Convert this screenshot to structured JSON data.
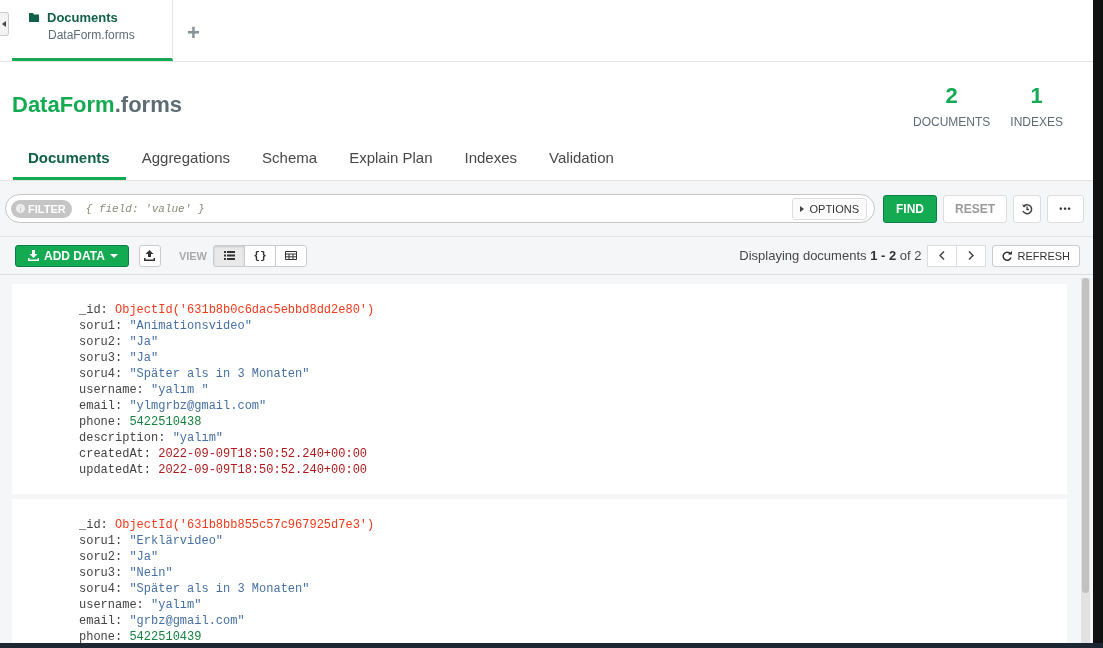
{
  "workspace_tabs": [
    {
      "title": "Documents",
      "subtitle": "DataForm.forms",
      "selected": true
    }
  ],
  "new_tab": "+",
  "collection": {
    "database": "DataForm",
    "name": ".forms"
  },
  "stats": [
    {
      "value": "2",
      "label": "DOCUMENTS"
    },
    {
      "value": "1",
      "label": "INDEXES"
    }
  ],
  "tabs": [
    {
      "label": "Documents",
      "selected": true
    },
    {
      "label": "Aggregations",
      "selected": false
    },
    {
      "label": "Schema",
      "selected": false
    },
    {
      "label": "Explain Plan",
      "selected": false
    },
    {
      "label": "Indexes",
      "selected": false
    },
    {
      "label": "Validation",
      "selected": false
    }
  ],
  "query_bar": {
    "filter_label": "FILTER",
    "placeholder": "{ field: 'value' }",
    "options": "OPTIONS",
    "find": "FIND",
    "reset": "RESET",
    "more": "•••"
  },
  "toolbar": {
    "add_data": "ADD DATA",
    "view_label": "VIEW",
    "views": [
      {
        "kind": "list",
        "selected": true
      },
      {
        "kind": "json",
        "label": "{}",
        "selected": false
      },
      {
        "kind": "table",
        "selected": false
      }
    ],
    "pagination": "Displaying documents **1 - 2** of 2",
    "refresh": "REFRESH"
  },
  "documents": [
    {
      "fields": [
        {
          "key": "_id:",
          "value": "ObjectId('631b8b0c6dac5ebbd8dd2e80')",
          "kind": "objectid"
        },
        {
          "key": "soru1:",
          "value": "\"Animationsvideo\"",
          "kind": "string"
        },
        {
          "key": "soru2:",
          "value": "\"Ja\"",
          "kind": "string"
        },
        {
          "key": "soru3:",
          "value": "\"Ja\"",
          "kind": "string"
        },
        {
          "key": "soru4:",
          "value": "\"Später als in 3 Monaten\"",
          "kind": "string"
        },
        {
          "key": "username:",
          "value": "\"yalım \"",
          "kind": "string"
        },
        {
          "key": "email:",
          "value": "\"ylmgrbz@gmail.com\"",
          "kind": "string"
        },
        {
          "key": "phone:",
          "value": "5422510438",
          "kind": "number"
        },
        {
          "key": "description:",
          "value": "\"yalım\"",
          "kind": "string"
        },
        {
          "key": "createdAt:",
          "value": "2022-09-09T18:50:52.240+00:00",
          "kind": "date"
        },
        {
          "key": "updatedAt:",
          "value": "2022-09-09T18:50:52.240+00:00",
          "kind": "date"
        }
      ]
    },
    {
      "fields": [
        {
          "key": "_id:",
          "value": "ObjectId('631b8bb855c57c967925d7e3')",
          "kind": "objectid"
        },
        {
          "key": "soru1:",
          "value": "\"Erklärvideo\"",
          "kind": "string"
        },
        {
          "key": "soru2:",
          "value": "\"Ja\"",
          "kind": "string"
        },
        {
          "key": "soru3:",
          "value": "\"Nein\"",
          "kind": "string"
        },
        {
          "key": "soru4:",
          "value": "\"Später als in 3 Monaten\"",
          "kind": "string"
        },
        {
          "key": "username:",
          "value": "\"yalım\"",
          "kind": "string"
        },
        {
          "key": "email:",
          "value": "\"grbz@gmail.com\"",
          "kind": "string"
        },
        {
          "key": "phone:",
          "value": "5422510439",
          "kind": "number"
        }
      ]
    }
  ]
}
